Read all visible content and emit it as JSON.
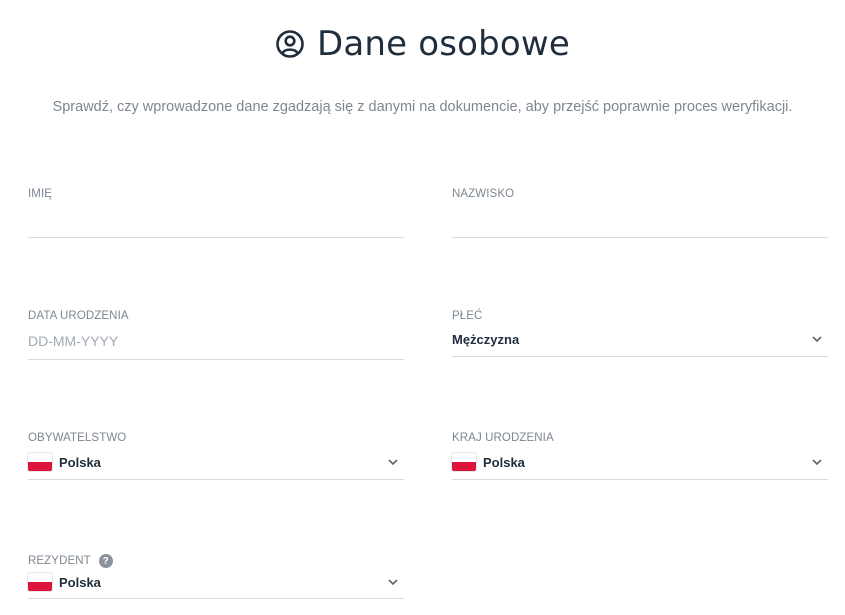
{
  "header": {
    "title": "Dane osobowe",
    "icon": "user-circle-icon",
    "subtitle": "Sprawdź, czy wprowadzone dane zgadzają się z danymi na dokumencie, aby przejść poprawnie proces weryfikacji."
  },
  "form": {
    "first_name": {
      "label": "IMIĘ",
      "value": ""
    },
    "last_name": {
      "label": "NAZWISKO",
      "value": ""
    },
    "birth_date": {
      "label": "DATA URODZENIA",
      "placeholder": "DD-MM-YYYY",
      "value": ""
    },
    "gender": {
      "label": "PŁEĆ",
      "value": "Mężczyzna",
      "icon": "chevron-down-icon"
    },
    "citizenship": {
      "label": "OBYWATELSTWO",
      "value": "Polska",
      "flag": "poland-flag-icon",
      "icon": "chevron-down-icon"
    },
    "birth_country": {
      "label": "KRAJ URODZENIA",
      "value": "Polska",
      "flag": "poland-flag-icon",
      "icon": "chevron-down-icon"
    },
    "resident": {
      "label": "REZYDENT",
      "value": "Polska",
      "flag": "poland-flag-icon",
      "help_icon": "question-mark-icon",
      "icon": "chevron-down-icon"
    }
  },
  "colors": {
    "text": "#1f2d3d",
    "muted": "#7d8791",
    "border": "#d6dadf",
    "flag_red": "#dc143c"
  }
}
